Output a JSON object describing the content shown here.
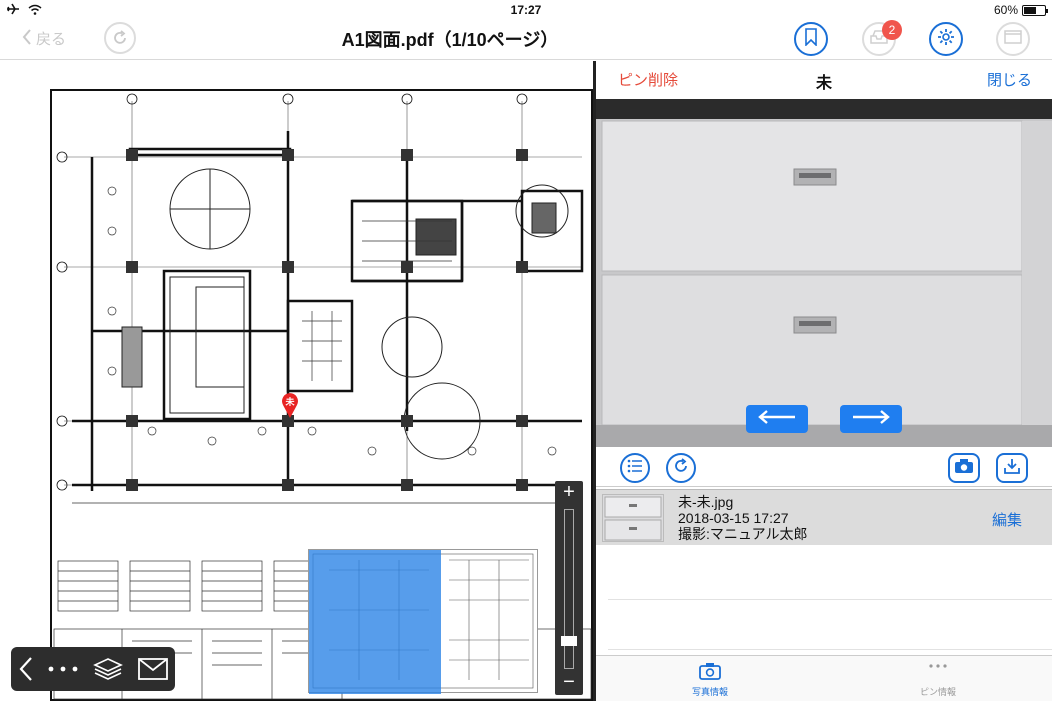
{
  "status_bar": {
    "time": "17:27",
    "battery_text": "60%",
    "battery_level": 0.6
  },
  "nav": {
    "back_label": "戻る",
    "title": "A1図面.pdf（1/10ページ）",
    "badge_count": "2"
  },
  "drawing": {
    "pin_label": "未",
    "zoom_level": 0.15
  },
  "panel": {
    "pin_delete_label": "ピン削除",
    "title": "未",
    "close_label": "閉じる"
  },
  "photo_list": {
    "items": [
      {
        "filename": "未-未.jpg",
        "datetime": "2018-03-15 17:27",
        "photographer": "撮影:マニュアル太郎",
        "edit_label": "編集"
      }
    ]
  },
  "tabs": [
    {
      "label": "写真情報",
      "icon": "camera-icon",
      "active": true
    },
    {
      "label": "ピン情報",
      "icon": "more-dots-icon",
      "active": false
    }
  ],
  "colors": {
    "accent": "#1a6fd6",
    "danger": "#e54a3a",
    "badge": "#f0554c",
    "arrow": "#1f7ef0"
  }
}
